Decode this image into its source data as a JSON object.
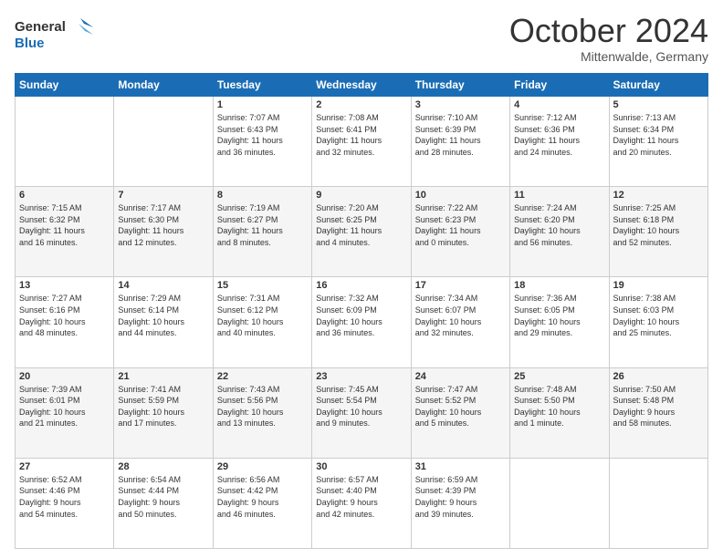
{
  "header": {
    "logo_line1": "General",
    "logo_line2": "Blue",
    "month": "October 2024",
    "location": "Mittenwalde, Germany"
  },
  "days_of_week": [
    "Sunday",
    "Monday",
    "Tuesday",
    "Wednesday",
    "Thursday",
    "Friday",
    "Saturday"
  ],
  "weeks": [
    [
      {
        "day": "",
        "info": ""
      },
      {
        "day": "",
        "info": ""
      },
      {
        "day": "1",
        "info": "Sunrise: 7:07 AM\nSunset: 6:43 PM\nDaylight: 11 hours\nand 36 minutes."
      },
      {
        "day": "2",
        "info": "Sunrise: 7:08 AM\nSunset: 6:41 PM\nDaylight: 11 hours\nand 32 minutes."
      },
      {
        "day": "3",
        "info": "Sunrise: 7:10 AM\nSunset: 6:39 PM\nDaylight: 11 hours\nand 28 minutes."
      },
      {
        "day": "4",
        "info": "Sunrise: 7:12 AM\nSunset: 6:36 PM\nDaylight: 11 hours\nand 24 minutes."
      },
      {
        "day": "5",
        "info": "Sunrise: 7:13 AM\nSunset: 6:34 PM\nDaylight: 11 hours\nand 20 minutes."
      }
    ],
    [
      {
        "day": "6",
        "info": "Sunrise: 7:15 AM\nSunset: 6:32 PM\nDaylight: 11 hours\nand 16 minutes."
      },
      {
        "day": "7",
        "info": "Sunrise: 7:17 AM\nSunset: 6:30 PM\nDaylight: 11 hours\nand 12 minutes."
      },
      {
        "day": "8",
        "info": "Sunrise: 7:19 AM\nSunset: 6:27 PM\nDaylight: 11 hours\nand 8 minutes."
      },
      {
        "day": "9",
        "info": "Sunrise: 7:20 AM\nSunset: 6:25 PM\nDaylight: 11 hours\nand 4 minutes."
      },
      {
        "day": "10",
        "info": "Sunrise: 7:22 AM\nSunset: 6:23 PM\nDaylight: 11 hours\nand 0 minutes."
      },
      {
        "day": "11",
        "info": "Sunrise: 7:24 AM\nSunset: 6:20 PM\nDaylight: 10 hours\nand 56 minutes."
      },
      {
        "day": "12",
        "info": "Sunrise: 7:25 AM\nSunset: 6:18 PM\nDaylight: 10 hours\nand 52 minutes."
      }
    ],
    [
      {
        "day": "13",
        "info": "Sunrise: 7:27 AM\nSunset: 6:16 PM\nDaylight: 10 hours\nand 48 minutes."
      },
      {
        "day": "14",
        "info": "Sunrise: 7:29 AM\nSunset: 6:14 PM\nDaylight: 10 hours\nand 44 minutes."
      },
      {
        "day": "15",
        "info": "Sunrise: 7:31 AM\nSunset: 6:12 PM\nDaylight: 10 hours\nand 40 minutes."
      },
      {
        "day": "16",
        "info": "Sunrise: 7:32 AM\nSunset: 6:09 PM\nDaylight: 10 hours\nand 36 minutes."
      },
      {
        "day": "17",
        "info": "Sunrise: 7:34 AM\nSunset: 6:07 PM\nDaylight: 10 hours\nand 32 minutes."
      },
      {
        "day": "18",
        "info": "Sunrise: 7:36 AM\nSunset: 6:05 PM\nDaylight: 10 hours\nand 29 minutes."
      },
      {
        "day": "19",
        "info": "Sunrise: 7:38 AM\nSunset: 6:03 PM\nDaylight: 10 hours\nand 25 minutes."
      }
    ],
    [
      {
        "day": "20",
        "info": "Sunrise: 7:39 AM\nSunset: 6:01 PM\nDaylight: 10 hours\nand 21 minutes."
      },
      {
        "day": "21",
        "info": "Sunrise: 7:41 AM\nSunset: 5:59 PM\nDaylight: 10 hours\nand 17 minutes."
      },
      {
        "day": "22",
        "info": "Sunrise: 7:43 AM\nSunset: 5:56 PM\nDaylight: 10 hours\nand 13 minutes."
      },
      {
        "day": "23",
        "info": "Sunrise: 7:45 AM\nSunset: 5:54 PM\nDaylight: 10 hours\nand 9 minutes."
      },
      {
        "day": "24",
        "info": "Sunrise: 7:47 AM\nSunset: 5:52 PM\nDaylight: 10 hours\nand 5 minutes."
      },
      {
        "day": "25",
        "info": "Sunrise: 7:48 AM\nSunset: 5:50 PM\nDaylight: 10 hours\nand 1 minute."
      },
      {
        "day": "26",
        "info": "Sunrise: 7:50 AM\nSunset: 5:48 PM\nDaylight: 9 hours\nand 58 minutes."
      }
    ],
    [
      {
        "day": "27",
        "info": "Sunrise: 6:52 AM\nSunset: 4:46 PM\nDaylight: 9 hours\nand 54 minutes."
      },
      {
        "day": "28",
        "info": "Sunrise: 6:54 AM\nSunset: 4:44 PM\nDaylight: 9 hours\nand 50 minutes."
      },
      {
        "day": "29",
        "info": "Sunrise: 6:56 AM\nSunset: 4:42 PM\nDaylight: 9 hours\nand 46 minutes."
      },
      {
        "day": "30",
        "info": "Sunrise: 6:57 AM\nSunset: 4:40 PM\nDaylight: 9 hours\nand 42 minutes."
      },
      {
        "day": "31",
        "info": "Sunrise: 6:59 AM\nSunset: 4:39 PM\nDaylight: 9 hours\nand 39 minutes."
      },
      {
        "day": "",
        "info": ""
      },
      {
        "day": "",
        "info": ""
      }
    ]
  ]
}
